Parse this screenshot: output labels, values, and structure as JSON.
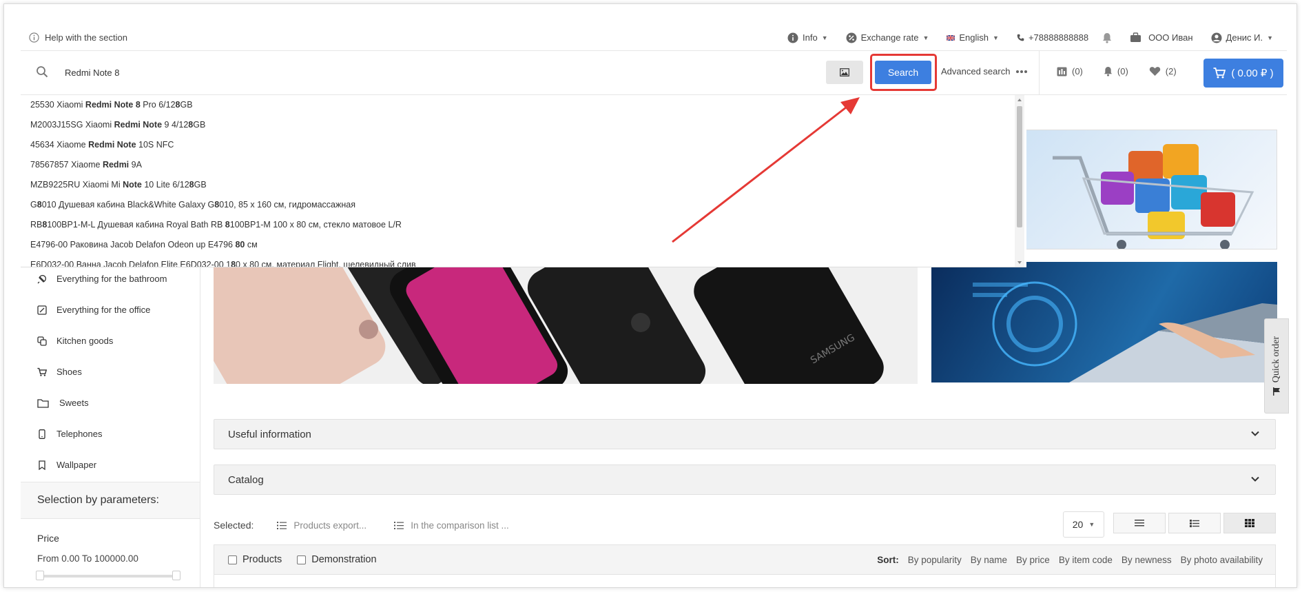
{
  "topbar": {
    "help_label": "Help with the section",
    "info_label": "Info",
    "exchange_label": "Exchange rate",
    "language_label": "English",
    "phone": "+78888888888",
    "company": "ООО Иван",
    "user": "Денис И."
  },
  "search": {
    "value": "Redmi Note 8",
    "button_label": "Search",
    "advanced_label": "Advanced search"
  },
  "counters": {
    "compare": "(0)",
    "notifications": "(0)",
    "favorites": "(2)",
    "cart_total": "( 0.00 ₽ )"
  },
  "suggestions": [
    [
      "25530 Xiaomi ",
      "Redmi Note 8",
      " Pro 6/12",
      "8",
      "GB"
    ],
    [
      "M2003J15SG Xiaomi ",
      "Redmi Note",
      " 9 4/12",
      "8",
      "GB"
    ],
    [
      "45634 Xiaome ",
      "Redmi Note",
      " 10S NFC",
      "",
      ""
    ],
    [
      "78567857 Xiaome ",
      "Redmi",
      " 9A",
      "",
      ""
    ],
    [
      "MZB9225RU Xiaomi Mi ",
      "Note",
      " 10 Lite 6/12",
      "8",
      "GB"
    ],
    [
      "G",
      "8",
      "010 Душевая кабина Black&White Galaxy G",
      "8",
      "010, 85 x 160 см, гидромассажная"
    ],
    [
      "RB",
      "8",
      "100BP1-M-L Душевая кабина Royal Bath RB ",
      "8",
      "100BP1-M 100 x 80 см, стекло матовое L/R"
    ],
    [
      "E4796-00 Раковина Jacob Delafon Odeon up E4796 ",
      "80",
      " см",
      "",
      ""
    ],
    [
      "E6D032-00 Ванна Jacob Delafon Elite E6D032-00 1",
      "8",
      "0 x 80 см, материал Flight, щелевидный слив",
      "",
      ""
    ]
  ],
  "sidebar": {
    "categories": [
      {
        "label": "Everything for the bathroom",
        "icon": "bathroom-icon"
      },
      {
        "label": "Everything for the office",
        "icon": "office-icon"
      },
      {
        "label": "Kitchen goods",
        "icon": "kitchen-icon"
      },
      {
        "label": "Shoes",
        "icon": "cart-icon"
      },
      {
        "label": "Sweets",
        "icon": "folder-icon"
      },
      {
        "label": "Telephones",
        "icon": "phone-icon"
      },
      {
        "label": "Wallpaper",
        "icon": "bookmark-icon"
      }
    ],
    "selection_title": "Selection by parameters:",
    "price_label": "Price",
    "price_range": "From 0.00 To 100000.00"
  },
  "main": {
    "useful_info_label": "Useful information",
    "catalog_label": "Catalog",
    "selected_label": "Selected:",
    "products_export_label": "Products export...",
    "comparison_label": "In the comparison list ...",
    "per_page": "20",
    "products_checkbox": "Products",
    "demo_checkbox": "Demonstration",
    "sort_label": "Sort:",
    "sort_options": [
      "By popularity",
      "By name",
      "By price",
      "By item code",
      "By newness",
      "By photo availability"
    ]
  },
  "quick_order_label": "Quick order",
  "banner_text": "SAMSUNG",
  "colors": {
    "accent": "#3d7fe0",
    "highlight": "#e53935"
  }
}
